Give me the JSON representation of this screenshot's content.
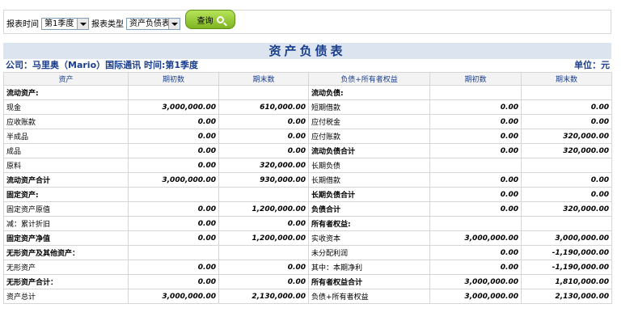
{
  "toolbar": {
    "period_label": "报表时间",
    "period_value": "第1季度",
    "type_label": "报表类型",
    "type_value": "资产负债表",
    "query_label": "查询"
  },
  "report": {
    "title": "资产负债表",
    "company_line": "公司：马里奥（Mario）国际通讯 时间:第1季度",
    "unit": "单位：元"
  },
  "table": {
    "headers": [
      "资产",
      "期初数",
      "期末数",
      "负债+所有者权益",
      "期初数",
      "期末数"
    ],
    "rows": [
      [
        "流动资产:",
        "",
        "",
        "流动负债:",
        "",
        ""
      ],
      [
        "现金",
        "3,000,000.00",
        "610,000.00",
        "短期借款",
        "0.00",
        "0.00"
      ],
      [
        "应收账款",
        "0.00",
        "0.00",
        "应付税金",
        "0.00",
        "0.00"
      ],
      [
        "半成品",
        "0.00",
        "0.00",
        "应付账款",
        "0.00",
        "320,000.00"
      ],
      [
        "成品",
        "0.00",
        "0.00",
        "流动负债合计",
        "0.00",
        "320,000.00"
      ],
      [
        "原料",
        "0.00",
        "320,000.00",
        "长期负债",
        "",
        ""
      ],
      [
        "流动资产合计",
        "3,000,000.00",
        "930,000.00",
        "长期借款",
        "0.00",
        "0.00"
      ],
      [
        "固定资产:",
        "",
        "",
        "长期负债合计",
        "0.00",
        "0.00"
      ],
      [
        "固定资产原值",
        "0.00",
        "1,200,000.00",
        "负债合计",
        "0.00",
        "320,000.00"
      ],
      [
        "减：累计折旧",
        "0.00",
        "0.00",
        "所有者权益:",
        "",
        ""
      ],
      [
        "固定资产净值",
        "0.00",
        "1,200,000.00",
        "实收资本",
        "3,000,000.00",
        "3,000,000.00"
      ],
      [
        "无形资产及其他资产：",
        "",
        "",
        "未分配利润",
        "0.00",
        "-1,190,000.00"
      ],
      [
        "无形资产",
        "0.00",
        "0.00",
        "其中：本期净利",
        "0.00",
        "-1,190,000.00"
      ],
      [
        "无形资产合计：",
        "0.00",
        "0.00",
        "所有者权益合计",
        "3,000,000.00",
        "1,810,000.00"
      ],
      [
        "资产总计",
        "3,000,000.00",
        "2,130,000.00",
        "负债+所有者权益",
        "3,000,000.00",
        "2,130,000.00"
      ]
    ]
  },
  "colors": {
    "accent": "#1a3e8c",
    "title_band": "#dbe4ef",
    "button": "#8cc63f"
  },
  "icons": {
    "query": "magnifier-icon",
    "dropdown": "chevron-down-icon"
  }
}
